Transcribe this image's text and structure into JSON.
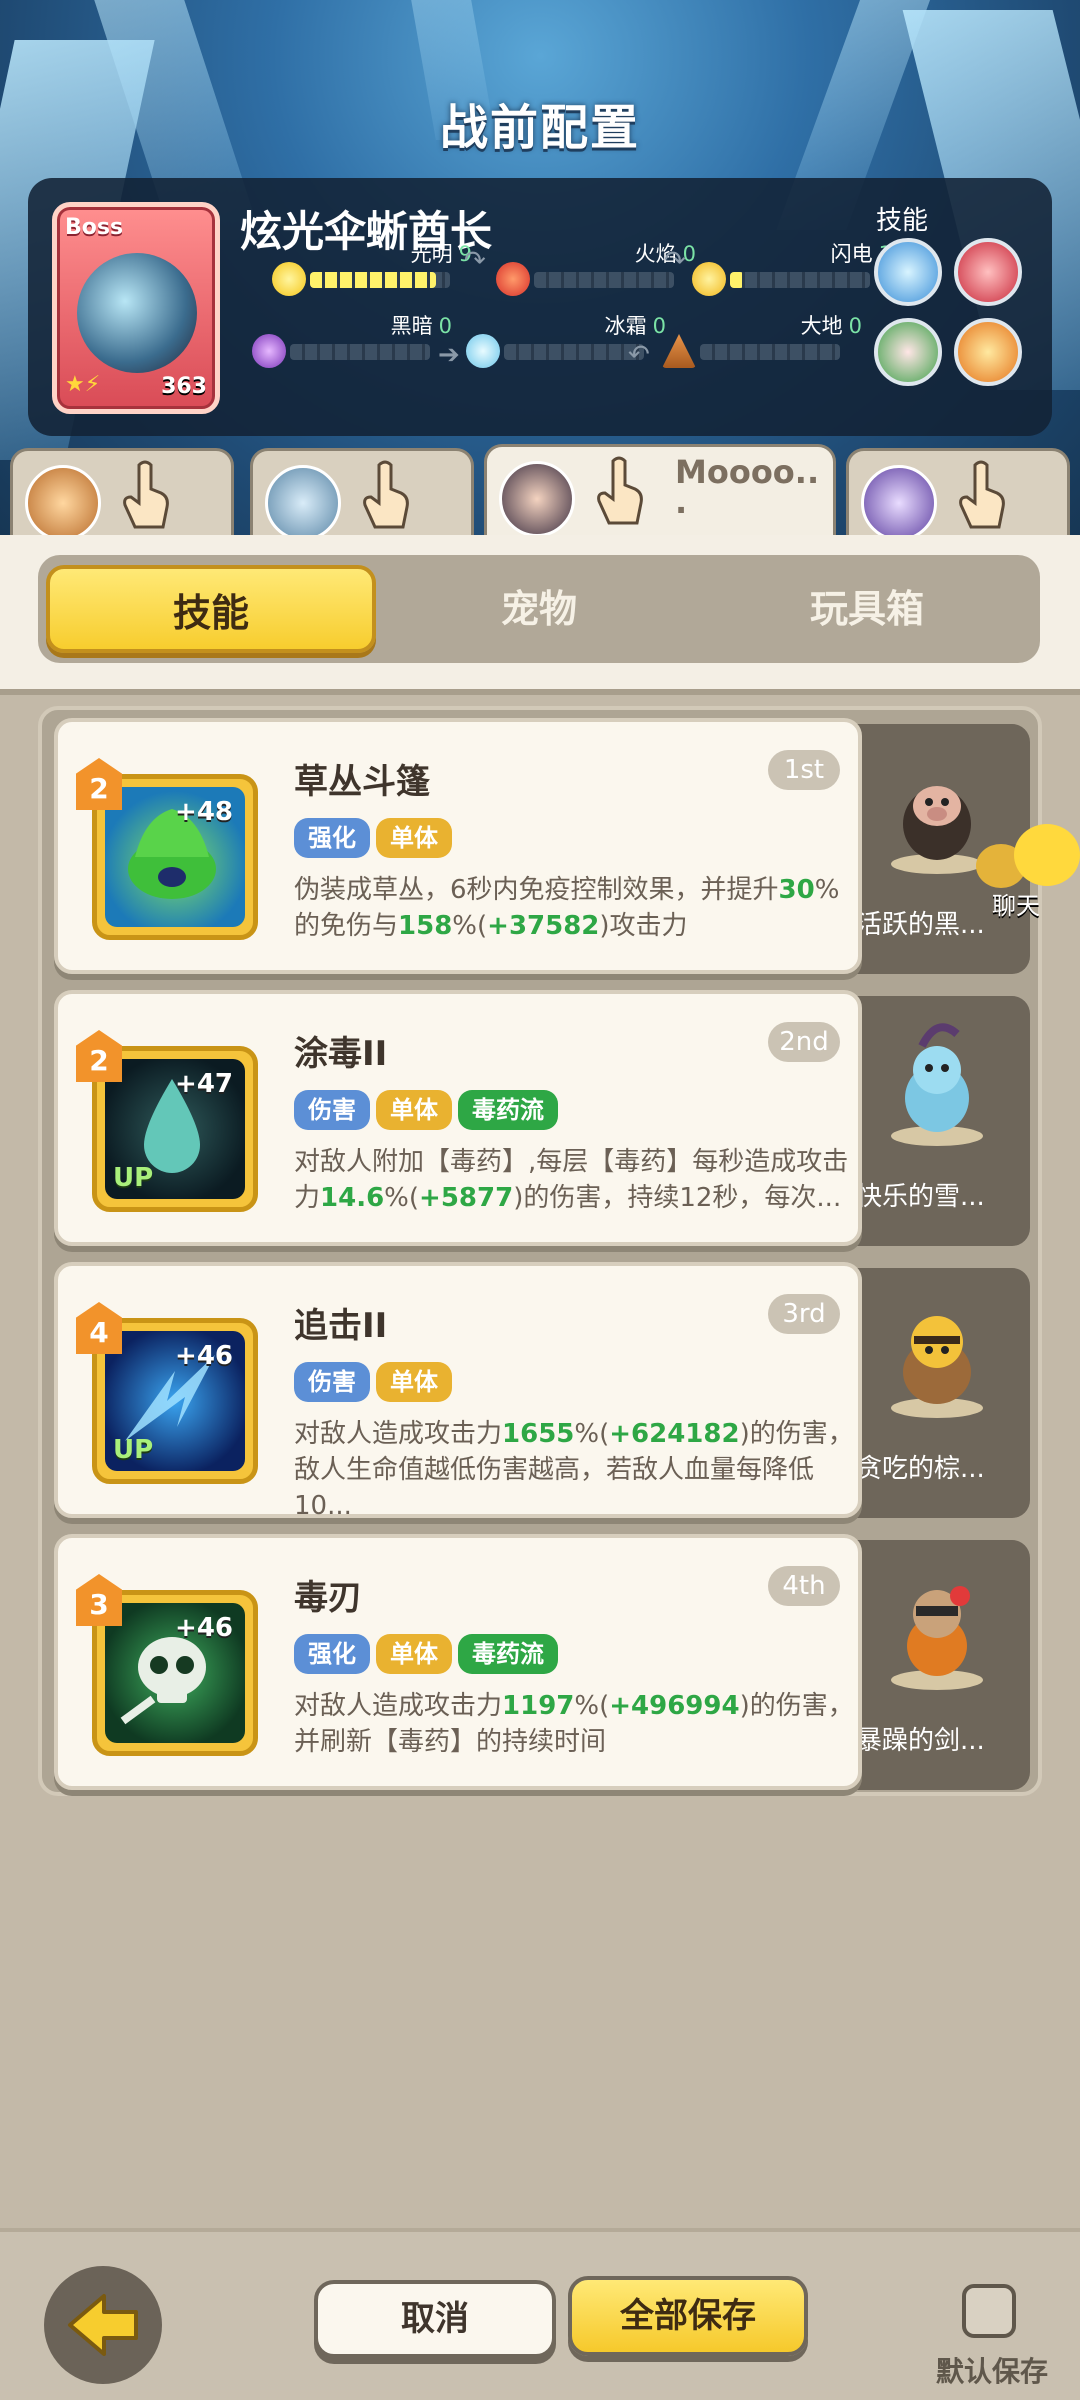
{
  "header": {
    "title": "战前配置"
  },
  "boss": {
    "tag": "Boss",
    "level": "363",
    "name": "炫光伞蜥酋长",
    "skills_label": "技能",
    "elements": [
      {
        "label": "光明",
        "value": "9",
        "level": 0.9
      },
      {
        "label": "火焰",
        "value": "0",
        "level": 0
      },
      {
        "label": "闪电",
        "value": "1",
        "level": 0.1
      },
      {
        "label": "黑暗",
        "value": "0",
        "level": 0
      },
      {
        "label": "冰霜",
        "value": "0",
        "level": 0
      },
      {
        "label": "大地",
        "value": "0",
        "level": 0
      }
    ]
  },
  "heroes": [
    {
      "name": ""
    },
    {
      "name": ""
    },
    {
      "name": "Moooo..\n."
    },
    {
      "name": ""
    }
  ],
  "tabs": {
    "skills": "技能",
    "pets": "宠物",
    "toybox": "玩具箱"
  },
  "skills": [
    {
      "level": "2",
      "plus": "+48",
      "up": "",
      "name": "草丛斗篷",
      "rank": "1st",
      "tags": [
        "强化",
        "单体"
      ],
      "desc": [
        "伪装成草丛，6秒内免疫控制效果，并提升",
        "30",
        "%的免伤与",
        "158",
        "%(",
        "+37582",
        ")攻击力"
      ],
      "pet": "活跃的黑..."
    },
    {
      "level": "2",
      "plus": "+47",
      "up": "UP",
      "name": "涂毒II",
      "rank": "2nd",
      "tags": [
        "伤害",
        "单体",
        "毒药流"
      ],
      "desc": [
        "对敌人附加【毒药】,每层【毒药】每秒造成攻击力",
        "14.6",
        "%(",
        "+5877",
        ")的伤害，持续12秒，每次..."
      ],
      "pet": "快乐的雪..."
    },
    {
      "level": "4",
      "plus": "+46",
      "up": "UP",
      "name": "追击II",
      "rank": "3rd",
      "tags": [
        "伤害",
        "单体"
      ],
      "desc": [
        "对敌人造成攻击力",
        "1655",
        "%(",
        "+624182",
        ")的伤害，敌人生命值越低伤害越高，若敌人血量每降低10..."
      ],
      "pet": "贪吃的棕..."
    },
    {
      "level": "3",
      "plus": "+46",
      "up": "",
      "name": "毒刃",
      "rank": "4th",
      "tags": [
        "强化",
        "单体",
        "毒药流"
      ],
      "desc": [
        "对敌人造成攻击力",
        "1197",
        "%(",
        "+496994",
        ")的伤害，并刷新【毒药】的持续时间"
      ],
      "pet": "暴躁的剑..."
    }
  ],
  "chat": {
    "label": "聊天"
  },
  "footer": {
    "cancel": "取消",
    "save_all": "全部保存",
    "default_save": "默认保存"
  },
  "colors": {
    "accent": "#f7cd2e",
    "highlight": "#2ea745",
    "tag_blue": "#5c8fd6",
    "tag_gold": "#e9b230",
    "tag_green": "#2ea745"
  }
}
